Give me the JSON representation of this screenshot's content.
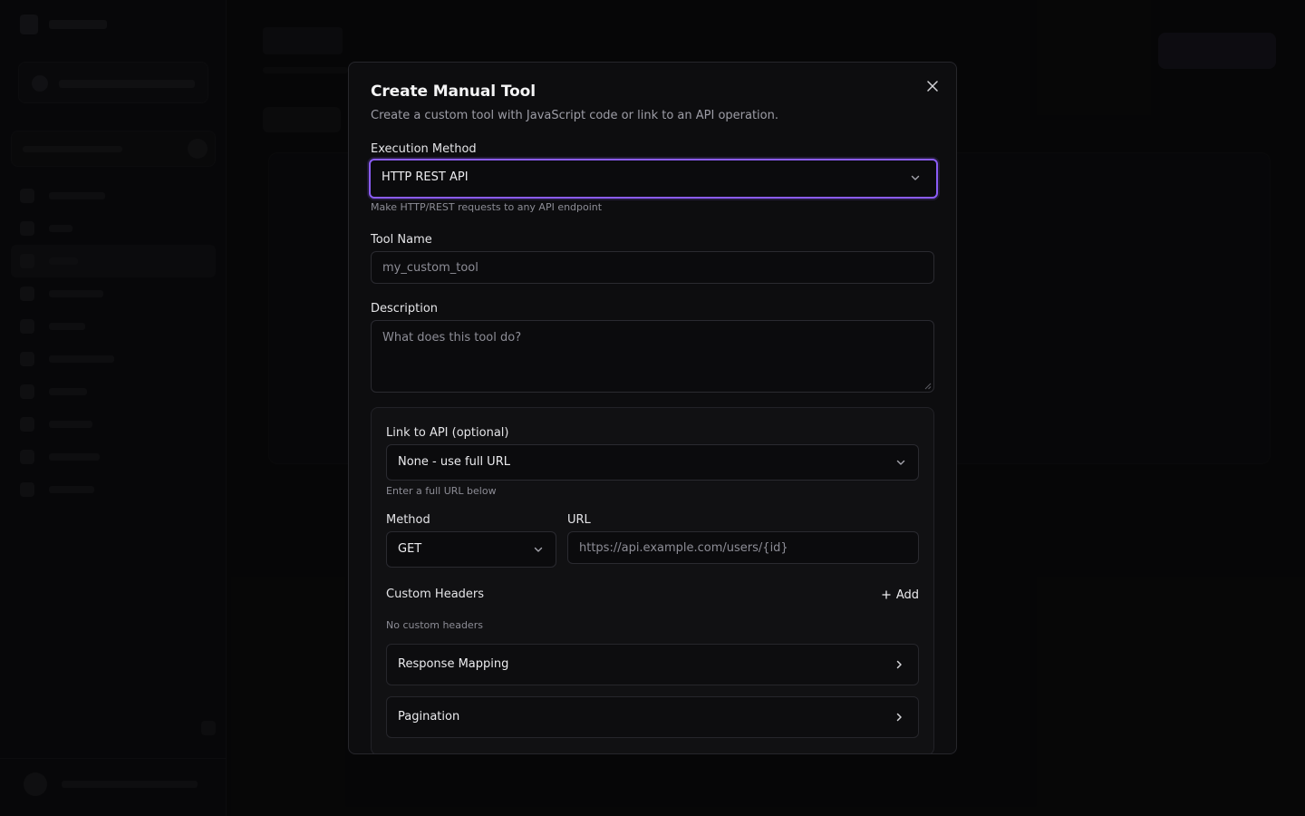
{
  "modal": {
    "title": "Create Manual Tool",
    "description": "Create a custom tool with JavaScript code or link to an API operation.",
    "execution_method": {
      "label": "Execution Method",
      "value": "HTTP REST API",
      "help": "Make HTTP/REST requests to any API endpoint"
    },
    "tool_name": {
      "label": "Tool Name",
      "placeholder": "my_custom_tool"
    },
    "description_field": {
      "label": "Description",
      "placeholder": "What does this tool do?"
    },
    "api": {
      "link_label": "Link to API (optional)",
      "link_value": "None - use full URL",
      "link_help": "Enter a full URL below",
      "method_label": "Method",
      "method_value": "GET",
      "url_label": "URL",
      "url_placeholder": "https://api.example.com/users/{id}",
      "headers_label": "Custom Headers",
      "add_label": "Add",
      "no_headers": "No custom headers",
      "response_mapping": "Response Mapping",
      "pagination": "Pagination"
    }
  },
  "colors": {
    "accent": "#8b5cf6",
    "modal_bg": "#0d0d0f",
    "page_bg": "#0a0a0b"
  },
  "icons": {
    "close": "close-icon",
    "dropdown": "chevron-down-icon",
    "expand": "chevron-right-icon",
    "add": "plus-icon"
  }
}
